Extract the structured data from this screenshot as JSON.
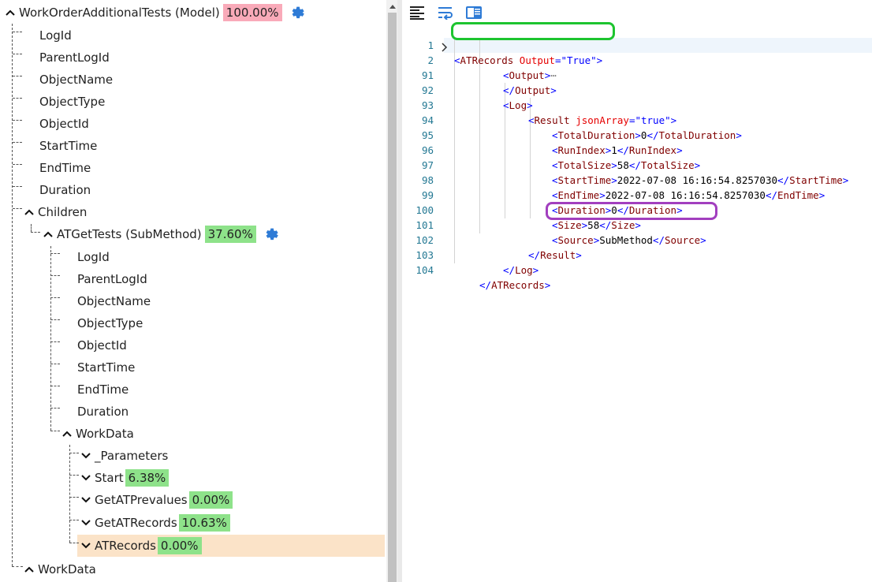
{
  "tree": {
    "root": {
      "label": "WorkOrderAdditionalTests (Model)",
      "percent": "100.00%",
      "percent_color": "#f9aab9"
    },
    "root_fields": [
      "LogId",
      "ParentLogId",
      "ObjectName",
      "ObjectType",
      "ObjectId",
      "StartTime",
      "EndTime",
      "Duration"
    ],
    "children_label": "Children",
    "submethod": {
      "label": "ATGetTests (SubMethod)",
      "percent": "37.60%",
      "percent_color": "#8ee28a"
    },
    "sub_fields": [
      "LogId",
      "ParentLogId",
      "ObjectName",
      "ObjectType",
      "ObjectId",
      "StartTime",
      "EndTime",
      "Duration"
    ],
    "workdata_label": "WorkData",
    "workdata_items": [
      {
        "label": "_Parameters",
        "percent": ""
      },
      {
        "label": "Start",
        "percent": "6.38%"
      },
      {
        "label": "GetATPrevalues",
        "percent": "0.00%"
      },
      {
        "label": "GetATRecords",
        "percent": "10.63%"
      },
      {
        "label": "ATRecords",
        "percent": "0.00%"
      }
    ],
    "bottom_workdata_label": "WorkData",
    "selected_item": "ATRecords",
    "selected_color": "#fbe3c8"
  },
  "editor": {
    "line_numbers": [
      "1",
      "2",
      "91",
      "92",
      "93",
      "94",
      "95",
      "96",
      "97",
      "98",
      "99",
      "100",
      "101",
      "102",
      "103",
      "104"
    ],
    "folded_ellipsis": "⋯",
    "total_duration": "0",
    "run_index": "1",
    "total_size": "58",
    "start_time": "2022-07-08 16:16:54.8257030",
    "end_time": "2022-07-08 16:16:54.8257030",
    "duration": "0",
    "size": "58",
    "source": "SubMethod",
    "output_attr_value": "\"True\"",
    "json_array_value": "\"true\"",
    "highlight_green": "#1dc42f",
    "highlight_purple": "#a23fbf"
  }
}
